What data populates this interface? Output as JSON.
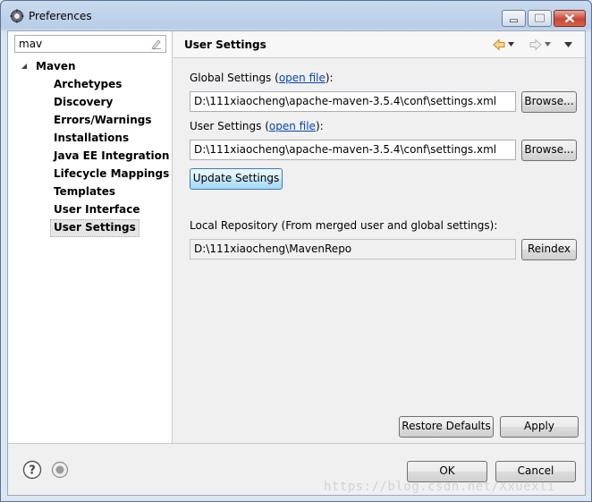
{
  "window": {
    "title": "Preferences"
  },
  "filter": {
    "value": "mav"
  },
  "tree": {
    "root": "Maven",
    "items": [
      "Archetypes",
      "Discovery",
      "Errors/Warnings",
      "Installations",
      "Java EE Integration",
      "Lifecycle Mappings",
      "Templates",
      "User Interface",
      "User Settings"
    ],
    "selected": "User Settings"
  },
  "page": {
    "title": "User Settings",
    "global_label_prefix": "Global Settings (",
    "global_link": "open file",
    "global_label_suffix": "):",
    "global_path": "D:\\111xiaocheng\\apache-maven-3.5.4\\conf\\settings.xml",
    "user_label_prefix": "User Settings (",
    "user_link": "open file",
    "user_label_suffix": "):",
    "user_path": "D:\\111xiaocheng\\apache-maven-3.5.4\\conf\\settings.xml",
    "browse_label": "Browse...",
    "update_label": "Update Settings",
    "local_repo_label": "Local Repository (From merged user and global settings):",
    "local_repo_path": "D:\\111xiaocheng\\MavenRepo",
    "reindex_label": "Reindex",
    "restore_label": "Restore Defaults",
    "apply_label": "Apply"
  },
  "footer": {
    "ok_label": "OK",
    "cancel_label": "Cancel",
    "watermark": "https://blog.csdn.net/Xxuexli"
  },
  "icons": {
    "title": "gear-icon",
    "back": "back-arrow-icon",
    "forward": "forward-arrow-icon",
    "menu": "view-menu-icon",
    "help": "help-icon",
    "record": "record-icon"
  },
  "colors": {
    "link": "#0645ad",
    "nav_arrow": "#e8a33c",
    "focus_button": "#bee6fd"
  }
}
